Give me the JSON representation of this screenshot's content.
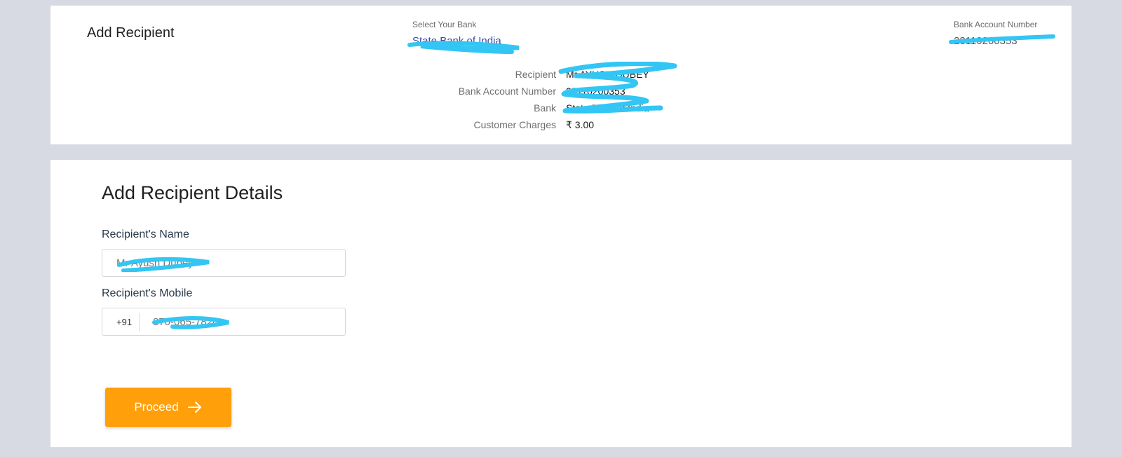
{
  "top_card": {
    "title": "Add Recipient",
    "bank_select": {
      "label": "Select Your Bank",
      "value": "State Bank of India"
    },
    "account_select": {
      "label": "Bank Account Number",
      "value": "23110200353"
    },
    "details": [
      {
        "label": "Recipient",
        "value": "Mr AYUSH DUBEY"
      },
      {
        "label": "Bank Account Number",
        "value": "23110200353"
      },
      {
        "label": "Bank",
        "value": "State Bank of India"
      },
      {
        "label": "Customer Charges",
        "value": "₹ 3.00"
      }
    ]
  },
  "form": {
    "title": "Add Recipient Details",
    "name_label": "Recipient's Name",
    "name_value": "Mr Ayush Dubey",
    "mobile_label": "Recipient's Mobile",
    "mobile_prefix": "+91",
    "mobile_value": "870-065-7820",
    "proceed_label": "Proceed"
  },
  "colors": {
    "background": "#d7d9e3",
    "accent": "#ff9f0a",
    "redaction": "#33c6f4"
  },
  "icons": {
    "proceed": "arrow-right-icon"
  }
}
